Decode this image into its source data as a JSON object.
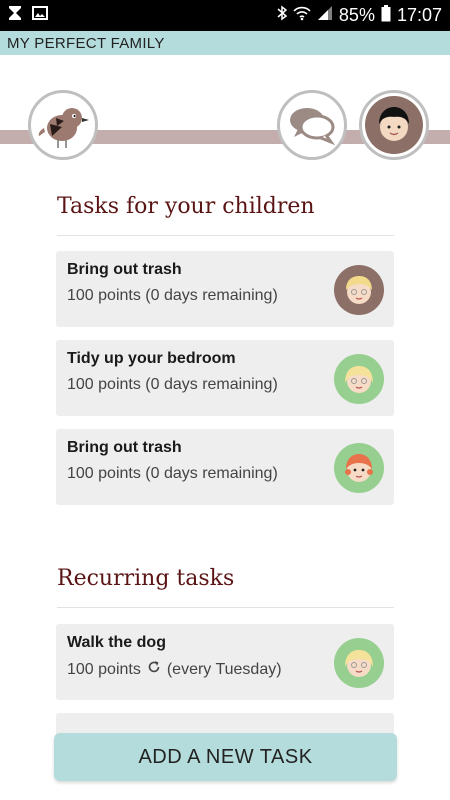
{
  "status_bar": {
    "battery": "85%",
    "time": "17:07",
    "icons": [
      "hourglass-icon",
      "image-icon",
      "bluetooth-icon",
      "wifi-icon",
      "signal-icon",
      "battery-icon"
    ]
  },
  "app": {
    "title": "MY PERFECT FAMILY"
  },
  "header": {
    "logo_icon": "bird-logo-icon",
    "chat_icon": "chat-bubbles-icon",
    "profile_icon": "parent-avatar-icon"
  },
  "children_tasks": {
    "title": "Tasks for your children",
    "items": [
      {
        "title": "Bring out trash",
        "subtitle": "100 points (0 days remaining)",
        "avatar_color": "#8c6f66"
      },
      {
        "title": "Tidy up your bedroom",
        "subtitle": "100 points (0 days remaining)",
        "avatar_color": "#96cf8f"
      },
      {
        "title": "Bring out trash",
        "subtitle": "100 points (0 days remaining)",
        "avatar_color": "#96cf8f"
      }
    ]
  },
  "recurring_tasks": {
    "title": "Recurring tasks",
    "items": [
      {
        "title": "Walk the dog",
        "points": "100 points",
        "schedule": "(every Tuesday)",
        "avatar_color": "#96cf8f"
      }
    ]
  },
  "add_button": {
    "label": "ADD A NEW TASK"
  },
  "colors": {
    "accent": "#b5dcdc",
    "title": "#5a1414",
    "strip": "#c4adad",
    "card": "#eeeeee"
  }
}
